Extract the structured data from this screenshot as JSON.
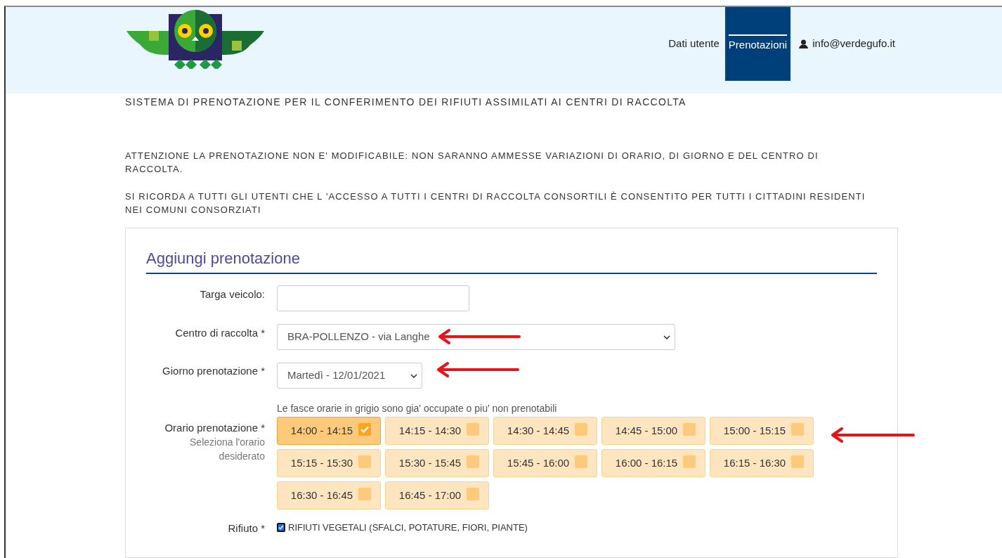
{
  "header": {
    "nav": [
      {
        "label": "Dati utente",
        "selected": false
      },
      {
        "label": "Prenotazioni",
        "selected": true
      }
    ],
    "user": "info@verdegufo.it"
  },
  "title": "SISTEMA DI PRENOTAZIONE PER IL CONFERIMENTO DEI RIFIUTI ASSIMILATI AI CENTRI DI RACCOLTA",
  "notices": [
    "ATTENZIONE LA PRENOTAZIONE NON E' MODIFICABILE: NON SARANNO AMMESSE VARIAZIONI DI ORARIO, DI GIORNO E DEL CENTRO DI RACCOLTA.",
    "SI RICORDA A TUTTI GLI UTENTI CHE L 'ACCESSO A TUTTI I CENTRI DI RACCOLTA CONSORTILI È CONSENTITO PER TUTTI I CITTADINI RESIDENTI NEI COMUNI CONSORZIATI"
  ],
  "form": {
    "title": "Aggiungi prenotazione",
    "plate": {
      "label": "Targa veicolo:"
    },
    "center": {
      "label": "Centro di raccolta",
      "required": "*",
      "value": "BRA-POLLENZO - via Langhe"
    },
    "day": {
      "label": "Giorno prenotazione",
      "required": "*",
      "value": "Martedì - 12/01/2021"
    },
    "time": {
      "label": "Orario prenotazione",
      "required": "*",
      "help": "Seleziona l'orario desiderato",
      "hint": "Le fasce orarie in grigio sono gia' occupate o piu' non prenotabili",
      "slots": [
        {
          "label": "14:00 - 14:15",
          "selected": true
        },
        {
          "label": "14:15 - 14:30",
          "selected": false
        },
        {
          "label": "14:30 - 14:45",
          "selected": false
        },
        {
          "label": "14:45 - 15:00",
          "selected": false
        },
        {
          "label": "15:00 - 15:15",
          "selected": false
        },
        {
          "label": "15:15 - 15:30",
          "selected": false
        },
        {
          "label": "15:30 - 15:45",
          "selected": false
        },
        {
          "label": "15:45 - 16:00",
          "selected": false
        },
        {
          "label": "16:00 - 16:15",
          "selected": false
        },
        {
          "label": "16:15 - 16:30",
          "selected": false
        },
        {
          "label": "16:30 - 16:45",
          "selected": false
        },
        {
          "label": "16:45 - 17:00",
          "selected": false
        }
      ]
    },
    "waste": {
      "label": "Rifiuto",
      "required": "*",
      "options": [
        {
          "label": "RIFIUTI VEGETALI (SFALCI, POTATURE, FIORI, PIANTE)",
          "checked": true
        }
      ]
    }
  }
}
